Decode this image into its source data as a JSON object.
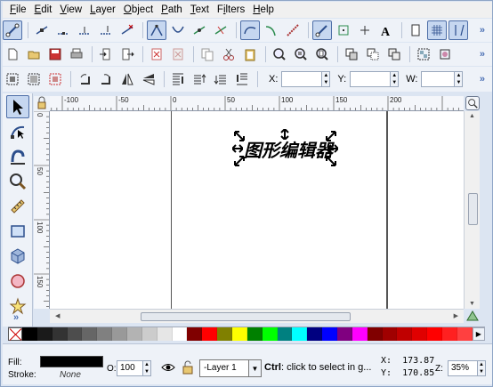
{
  "menubar": {
    "items": [
      {
        "label": "File",
        "key": "F",
        "rest": "ile"
      },
      {
        "label": "Edit",
        "key": "E",
        "rest": "dit"
      },
      {
        "label": "View",
        "key": "V",
        "rest": "iew"
      },
      {
        "label": "Layer",
        "key": "L",
        "rest": "ayer"
      },
      {
        "label": "Object",
        "key": "O",
        "rest": "bject"
      },
      {
        "label": "Path",
        "key": "P",
        "rest": "ath"
      },
      {
        "label": "Text",
        "key": "T",
        "rest": "ext"
      },
      {
        "label": "Filters",
        "key": "i",
        "rest": "lters",
        "prefix": "F"
      },
      {
        "label": "Help",
        "key": "H",
        "rest": "elp"
      }
    ]
  },
  "toolbar": {
    "more": "»"
  },
  "coords": {
    "x_label": "X:",
    "y_label": "Y:",
    "w_label": "W:"
  },
  "ruler": {
    "h_labels": [
      "-100",
      "-50",
      "0",
      "50",
      "100",
      "150",
      "200"
    ],
    "v_labels": [
      "0",
      "50",
      "100",
      "150"
    ]
  },
  "canvas": {
    "text": "图形编辑器"
  },
  "status": {
    "fill_label": "Fill:",
    "stroke_label": "Stroke:",
    "stroke_value": "None",
    "opacity_label": "O:",
    "opacity_value": "100",
    "layer": "-Layer 1",
    "message_bold": "Ctrl",
    "message": ": click to select in g...",
    "x_label": "X:",
    "x_value": "173.87",
    "y_label": "Y:",
    "y_value": "170.85",
    "zoom_label": "Z:",
    "zoom_value": "35%"
  },
  "palette": {
    "colors": [
      "#000000",
      "#1a1a1a",
      "#333333",
      "#4d4d4d",
      "#666666",
      "#808080",
      "#999999",
      "#b3b3b3",
      "#cccccc",
      "#e6e6e6",
      "#ffffff",
      "#800000",
      "#ff0000",
      "#808000",
      "#ffff00",
      "#008000",
      "#00ff00",
      "#008080",
      "#00ffff",
      "#000080",
      "#0000ff",
      "#800080",
      "#ff00ff",
      "#800000",
      "#a00000",
      "#c00000",
      "#e00000",
      "#ff0000",
      "#ff2020",
      "#ff4040"
    ]
  }
}
